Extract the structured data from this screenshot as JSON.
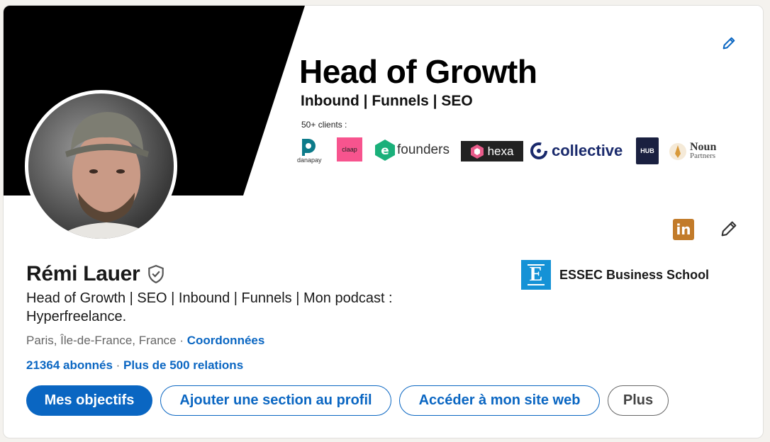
{
  "banner": {
    "title": "Head of Growth",
    "subtitle": "Inbound | Funnels | SEO",
    "clients_label": "50+ clients :",
    "logos": {
      "danapay": "danapay",
      "claap": "claap",
      "founders": "founders",
      "hexa": "hexa",
      "collective": "collective",
      "hub": "HUB",
      "noun": "Noun",
      "noun_sub": "Partners"
    }
  },
  "profile": {
    "name": "Rémi Lauer",
    "headline": "Head of Growth | SEO | Inbound | Funnels | Mon podcast : Hyperfreelance.",
    "location": "Paris, Île-de-France, France",
    "location_sep": " · ",
    "contact_link": "Coordonnées",
    "followers": "21364 abonnés",
    "stats_sep": " · ",
    "connections": "Plus de 500 relations"
  },
  "school": {
    "name": "ESSEC Business School",
    "logo_letter": "E"
  },
  "actions": {
    "primary": "Mes objectifs",
    "add_section": "Ajouter une section au profil",
    "website": "Accéder à mon site web",
    "more": "Plus"
  },
  "badge": {
    "label": "in"
  },
  "colors": {
    "linkedin_blue": "#0a66c2",
    "badge_gold": "#c27b2a",
    "essec_blue": "#1592d6"
  }
}
